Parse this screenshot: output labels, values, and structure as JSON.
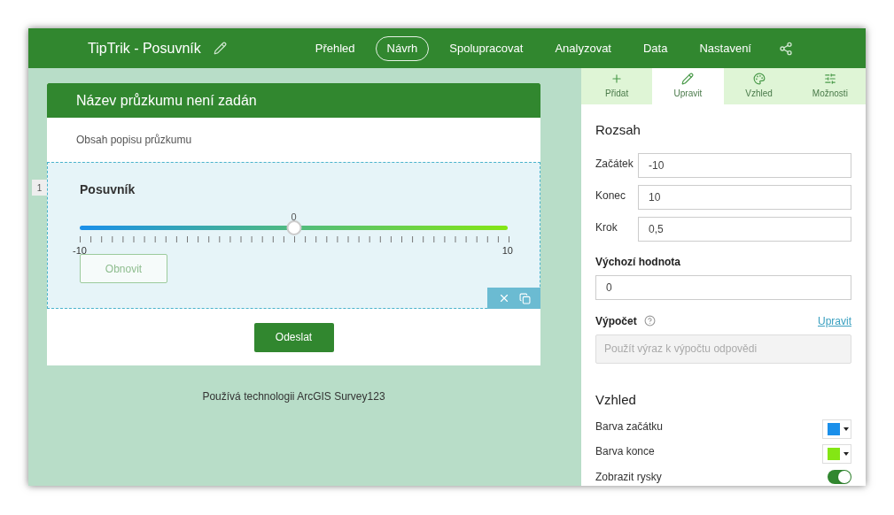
{
  "app": {
    "title": "TipTrik - Posuvník"
  },
  "nav": [
    {
      "label": "Přehled",
      "selected": false
    },
    {
      "label": "Návrh",
      "selected": true
    },
    {
      "label": "Spolupracovat",
      "selected": false
    },
    {
      "label": "Analyzovat",
      "selected": false
    },
    {
      "label": "Data",
      "selected": false
    },
    {
      "label": "Nastavení",
      "selected": false
    }
  ],
  "survey": {
    "title": "Název průzkumu není zadán",
    "description": "Obsah popisu průzkumu",
    "question": {
      "number": "1",
      "label": "Posuvník",
      "value": "0",
      "min_label": "-10",
      "max_label": "10",
      "level": 0.5,
      "reset_button": "Obnovit",
      "selected": true
    },
    "submit": "Odeslat",
    "footer": "Používá technologii ArcGIS Survey123"
  },
  "panel": {
    "tabs": [
      {
        "label": "Přidat",
        "kind": "plus",
        "selected": false
      },
      {
        "label": "Upravit",
        "kind": "pencil",
        "selected": true
      },
      {
        "label": "Vzhled",
        "kind": "palette",
        "selected": false
      },
      {
        "label": "Možnosti",
        "kind": "sliders",
        "selected": false
      }
    ],
    "range": {
      "heading": "Rozsah",
      "fields": [
        {
          "label": "Začátek",
          "value": "-10"
        },
        {
          "label": "Konec",
          "value": "10"
        },
        {
          "label": "Krok",
          "value": "0,5"
        }
      ]
    },
    "default": {
      "label": "Výchozí hodnota",
      "value": "0"
    },
    "calculation": {
      "label": "Výpočet",
      "link": "Upravit",
      "placeholder": "Použít výraz k výpočtu odpovědi"
    },
    "appearance": {
      "heading": "Vzhled",
      "colors": [
        {
          "label": "Barva začátku",
          "color": "#1a8fea"
        },
        {
          "label": "Barva konce",
          "color": "#84e614"
        }
      ],
      "toggle": {
        "label": "Zobrazit rysky",
        "on": true
      }
    }
  }
}
